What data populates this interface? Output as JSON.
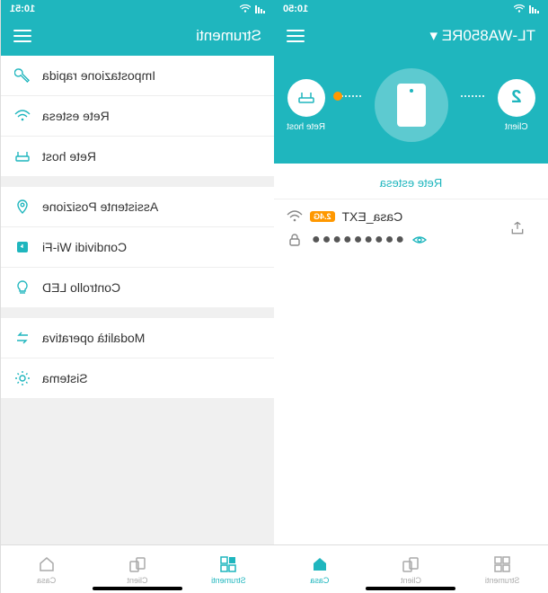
{
  "left": {
    "status": {
      "time": "10:51"
    },
    "header": {
      "title": "Strumenti"
    },
    "groups": [
      [
        {
          "label": "Impostazione rapida",
          "icon": "wrench"
        },
        {
          "label": "Rete estesa",
          "icon": "wifi"
        },
        {
          "label": "Rete host",
          "icon": "router"
        }
      ],
      [
        {
          "label": "Assistente Posizione",
          "icon": "location"
        },
        {
          "label": "Condividi Wi-Fi",
          "icon": "share"
        },
        {
          "label": "Controllo LED",
          "icon": "bulb"
        }
      ],
      [
        {
          "label": "Modalità operativa",
          "icon": "swap"
        },
        {
          "label": "Sistema",
          "icon": "gear"
        }
      ]
    ],
    "tabs": {
      "strumenti": "Strumenti",
      "client": "Client",
      "casa": "Casa"
    }
  },
  "right": {
    "status": {
      "time": "10:50"
    },
    "header": {
      "title": "TL-WA850RE ▾"
    },
    "hero": {
      "client_label": "Client",
      "client_count": "2",
      "host_label": "Rete host"
    },
    "section_label": "Rete estesa",
    "network": {
      "ssid": "Casa_EXT",
      "band": "2.4G",
      "password_dots": "●●●●●●●●●"
    },
    "tabs": {
      "strumenti": "Strumenti",
      "client": "Client",
      "casa": "Casa"
    }
  }
}
